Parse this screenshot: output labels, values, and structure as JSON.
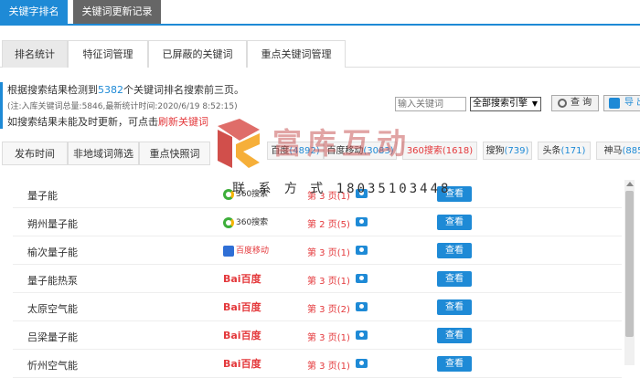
{
  "top_tabs": [
    "关键字排名",
    "关键词更新记录"
  ],
  "sub_tabs": [
    "排名统计",
    "特征词管理",
    "已屏蔽的关键词",
    "重点关键词管理"
  ],
  "info": {
    "line1_prefix": "根据搜索结果检测到",
    "line1_count": "5382",
    "line1_suffix": "个关键词排名搜索前三页。",
    "line2": "(注:入库关键词总量:5846,最新统计时间:2020/6/19 8:52:15)",
    "line3_prefix": "如搜索结果未能及时更新，可点击",
    "line3_link": "刷新关键词"
  },
  "search": {
    "placeholder": "输入关键词",
    "engine_selected": "全部搜索引擎",
    "query_label": "查 询",
    "export_label": "导 出"
  },
  "filter_tabs": [
    "发布时间",
    "非地域词筛选",
    "重点快照词"
  ],
  "engine_tabs": [
    {
      "name": "百度",
      "count": "(4892)"
    },
    {
      "name": "百度移动",
      "count": "(3083)"
    },
    {
      "name": "360搜索",
      "count": "(1618)"
    },
    {
      "name": "搜狗",
      "count": "(739)"
    },
    {
      "name": "头条",
      "count": "(171)"
    },
    {
      "name": "神马",
      "count": "(885"
    }
  ],
  "rows": [
    {
      "keyword": "量子能",
      "engine": "360搜索",
      "rank": "第 3 页(1)",
      "action": "查看"
    },
    {
      "keyword": "朔州量子能",
      "engine": "360搜索",
      "rank": "第 2 页(5)",
      "action": "查看"
    },
    {
      "keyword": "榆次量子能",
      "engine": "百度移动",
      "rank": "第 3 页(1)",
      "action": "查看"
    },
    {
      "keyword": "量子能热泵",
      "engine": "Bai百度",
      "rank": "第 3 页(1)",
      "action": "查看"
    },
    {
      "keyword": "太原空气能",
      "engine": "Bai百度",
      "rank": "第 3 页(2)",
      "action": "查看"
    },
    {
      "keyword": "吕梁量子能",
      "engine": "Bai百度",
      "rank": "第 3 页(1)",
      "action": "查看"
    },
    {
      "keyword": "忻州空气能",
      "engine": "Bai百度",
      "rank": "第 3 页(1)",
      "action": "查看"
    }
  ],
  "watermark": {
    "brand": "富库互动",
    "contact": "联 系 方 式 18035103448"
  },
  "colors": {
    "accent": "#1e8ad6",
    "rank_red": "#e4393c"
  }
}
